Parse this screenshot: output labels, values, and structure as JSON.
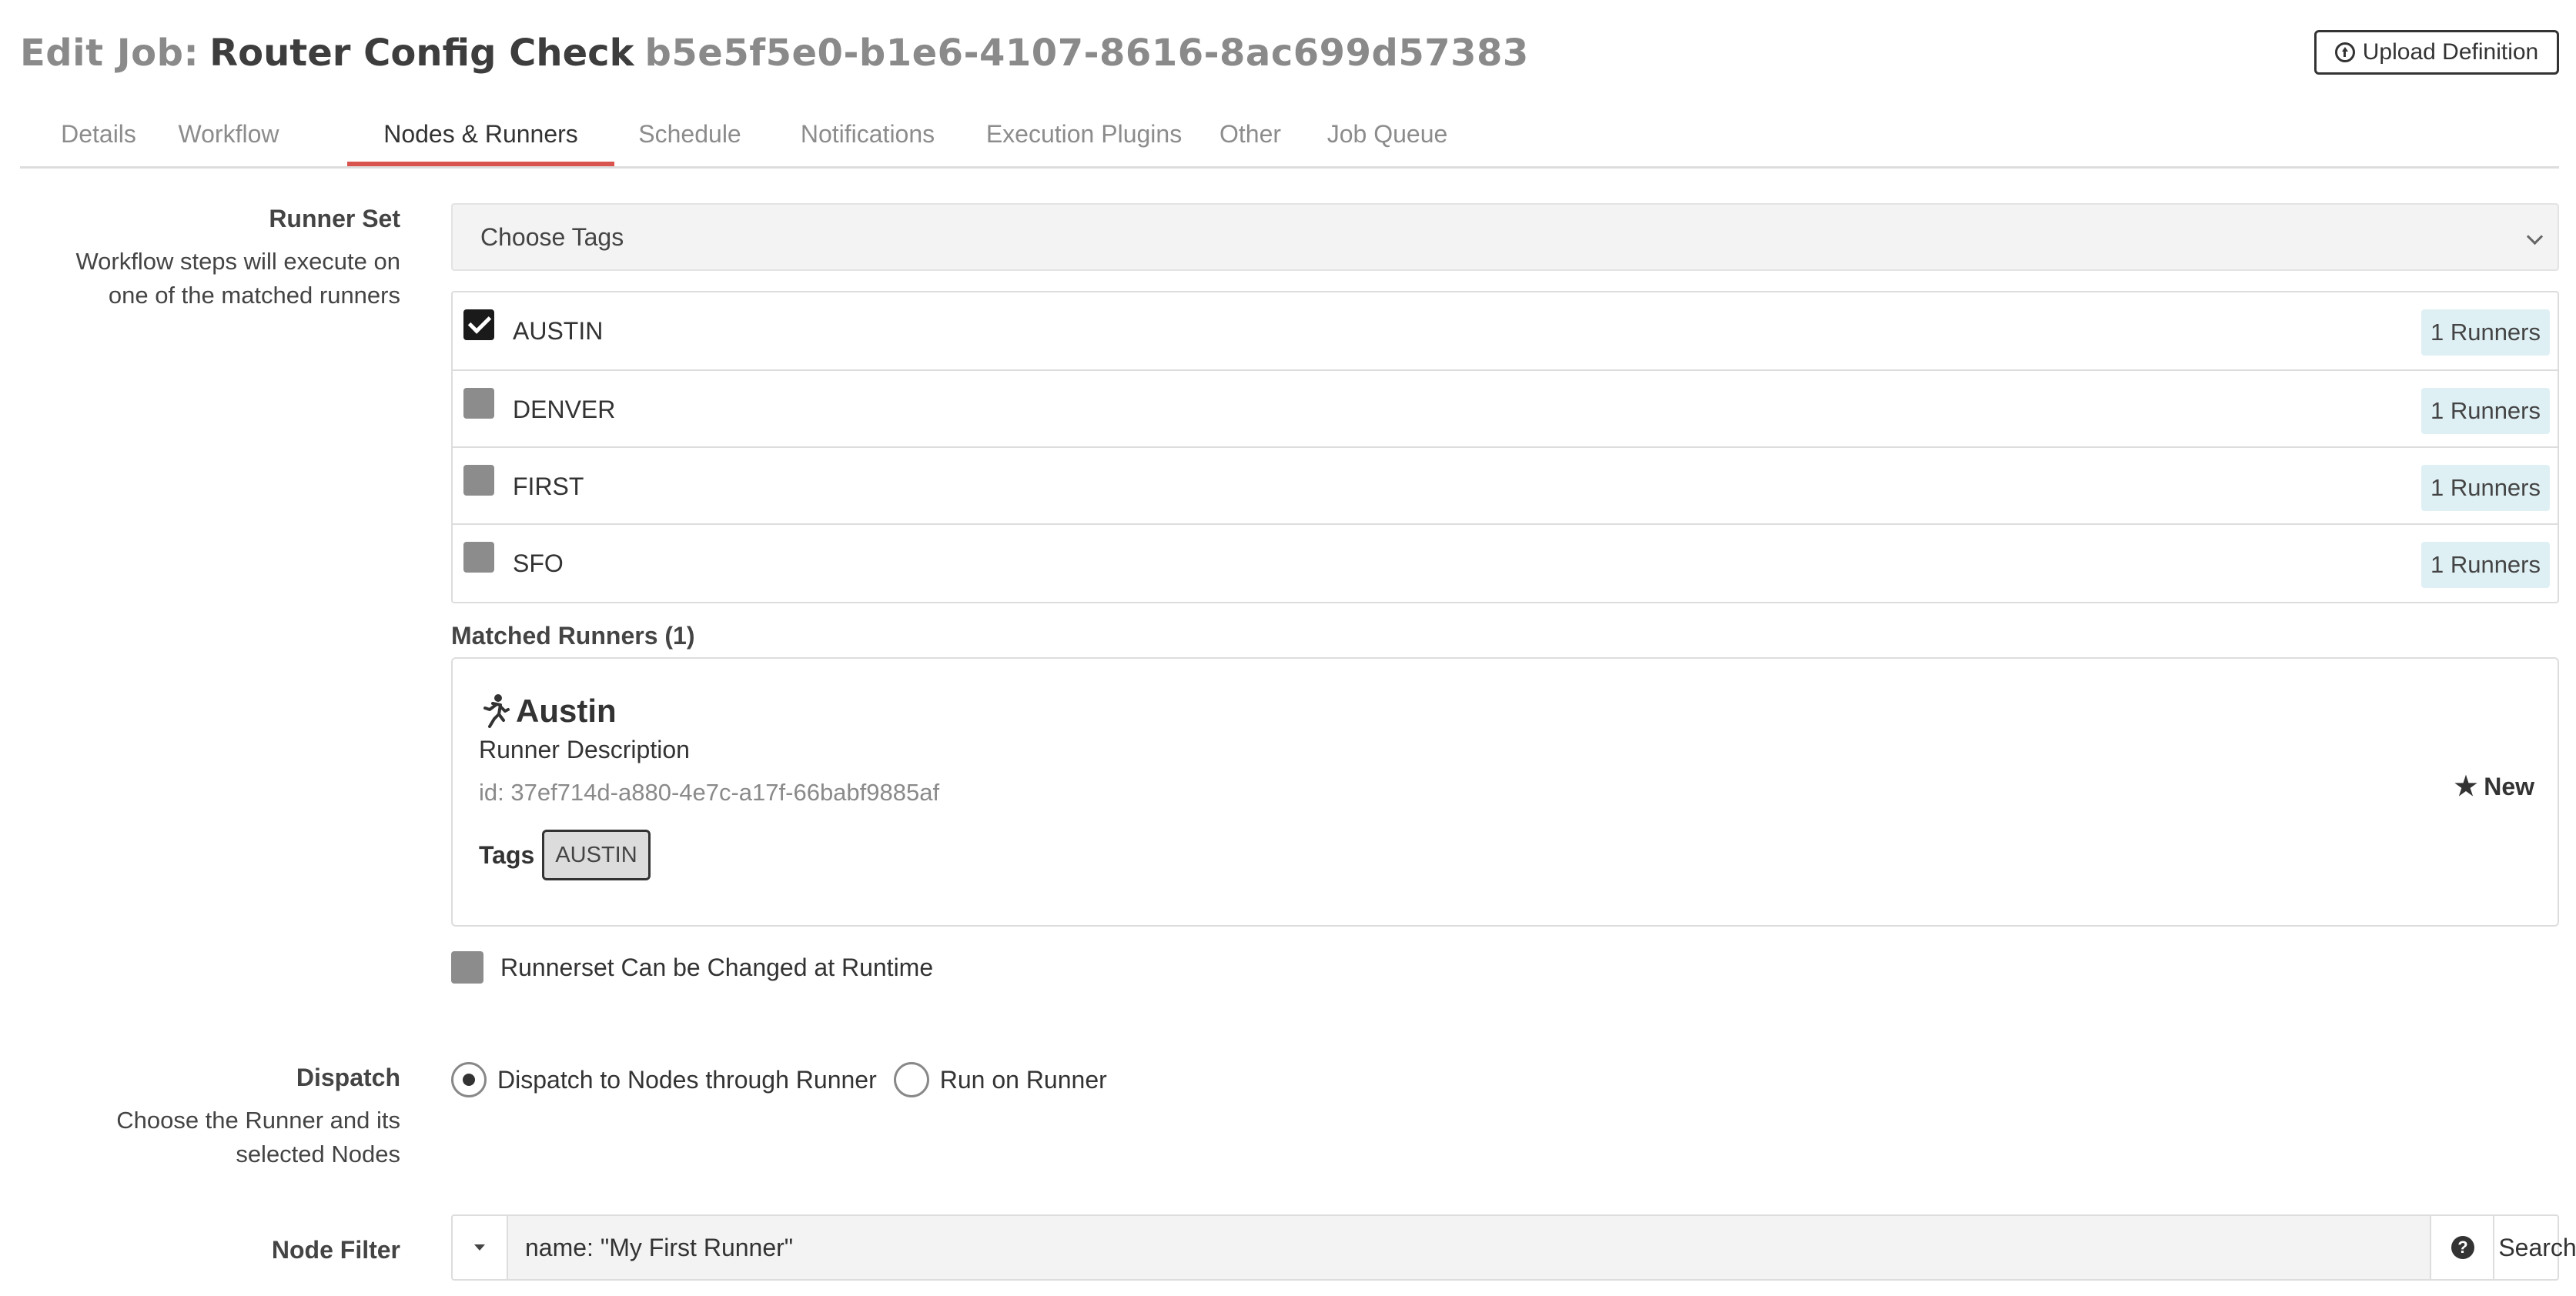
{
  "header": {
    "prefix": "Edit Job:",
    "job_name": "Router Config Check",
    "job_uuid": "b5e5f5e0-b1e6-4107-8616-8ac699d57383",
    "upload_label": "Upload Definition"
  },
  "tabs": [
    {
      "label": "Details",
      "active": false
    },
    {
      "label": "Workflow",
      "active": false
    },
    {
      "label": "Nodes & Runners",
      "active": true
    },
    {
      "label": "Schedule",
      "active": false
    },
    {
      "label": "Notifications",
      "active": false
    },
    {
      "label": "Execution Plugins",
      "active": false
    },
    {
      "label": "Other",
      "active": false
    },
    {
      "label": "Job Queue",
      "active": false
    }
  ],
  "runner_set": {
    "title": "Runner Set",
    "description_line1": "Workflow steps will execute on",
    "description_line2": "one of the matched runners",
    "select_placeholder": "Choose Tags",
    "tags": [
      {
        "name": "AUSTIN",
        "checked": true,
        "count": "1 Runners"
      },
      {
        "name": "DENVER",
        "checked": false,
        "count": "1 Runners"
      },
      {
        "name": "FIRST",
        "checked": false,
        "count": "1 Runners"
      },
      {
        "name": "SFO",
        "checked": false,
        "count": "1 Runners"
      }
    ],
    "matched_heading": "Matched Runners (1)",
    "runner": {
      "name": "Austin",
      "description": "Runner Description",
      "id_text": "id: 37ef714d-a880-4e7c-a17f-66babf9885af",
      "tags_label": "Tags",
      "tag": "AUSTIN",
      "badge": "New"
    },
    "runtime_label": "Runnerset Can be Changed at Runtime"
  },
  "dispatch": {
    "title": "Dispatch",
    "description_line1": "Choose the Runner and its",
    "description_line2": "selected Nodes",
    "options": [
      {
        "label": "Dispatch to Nodes through Runner",
        "selected": true
      },
      {
        "label": "Run on Runner",
        "selected": false
      }
    ]
  },
  "node_filter": {
    "title": "Node Filter",
    "value": "name: \"My First Runner\"",
    "search_label": "Search"
  },
  "colors": {
    "active_tab_underline": "#d9534f",
    "runner_count_bg": "#dff0f5"
  }
}
